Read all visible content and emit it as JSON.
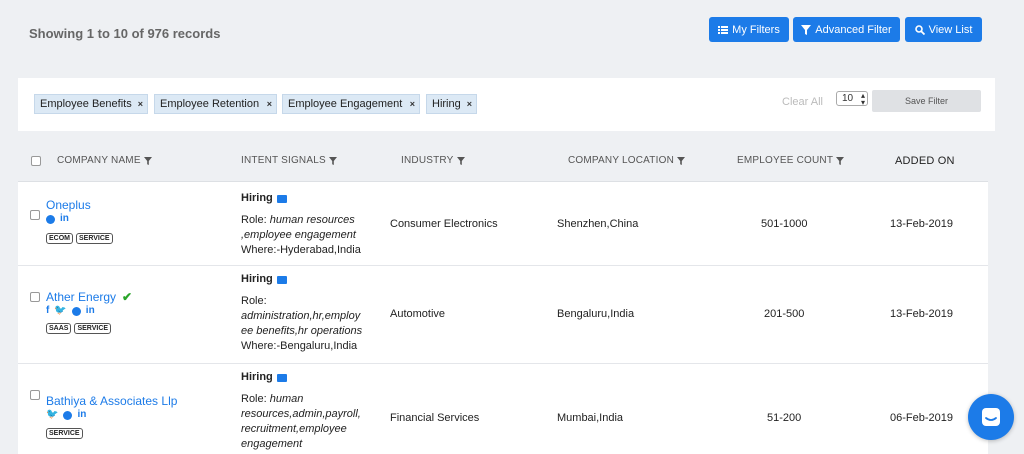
{
  "header": {
    "records_text": "Showing 1 to 10 of 976 records",
    "my_filters": "My Filters",
    "advanced_filter": "Advanced Filter",
    "view_list": "View List"
  },
  "filters": {
    "tags": [
      "Employee Benefits",
      "Employee Retention",
      "Employee Engagement",
      "Hiring"
    ],
    "remove_glyph": "×",
    "clear_all": "Clear All",
    "page_size": "10",
    "save_filter": "Save Filter"
  },
  "table": {
    "columns": {
      "company_name": "COMPANY NAME",
      "intent_signals": "INTENT SIGNALS",
      "industry": "INDUSTRY",
      "company_location": "COMPANY LOCATION",
      "employee_count": "EMPLOYEE COUNT",
      "added_on": "ADDED ON"
    },
    "rows": [
      {
        "name": "Oneplus",
        "verified": false,
        "socials": [
          "globe",
          "in"
        ],
        "badges": [
          "ECOM",
          "SERVICE"
        ],
        "signal": "Hiring",
        "role_label": "Role: ",
        "role": "human resources ,employee engagement",
        "where": "Where:-Hyderabad,India",
        "industry": "Consumer Electronics",
        "location": "Shenzhen,China",
        "employees": "501-1000",
        "added_on": "13-Feb-2019"
      },
      {
        "name": "Ather Energy",
        "verified": true,
        "socials": [
          "f",
          "twitter",
          "globe",
          "in"
        ],
        "badges": [
          "SAAS",
          "SERVICE"
        ],
        "signal": "Hiring",
        "role_label": "Role: ",
        "role": "administration,hr,employ ee benefits,hr operations",
        "where": "Where:-Bengaluru,India",
        "industry": "Automotive",
        "location": "Bengaluru,India",
        "employees": "201-500",
        "added_on": "13-Feb-2019"
      },
      {
        "name": "Bathiya & Associates Llp",
        "verified": false,
        "socials": [
          "twitter",
          "globe",
          "in"
        ],
        "badges": [
          "SERVICE"
        ],
        "signal": "Hiring",
        "role_label": "Role: ",
        "role": "human resources,admin,payroll, recruitment,employee engagement",
        "where": "",
        "industry": "Financial Services",
        "location": "Mumbai,India",
        "employees": "51-200",
        "added_on": "06-Feb-2019"
      }
    ]
  },
  "colors": {
    "accent": "#1c7be8",
    "verified": "#2aa52a",
    "page_bg": "#eef0f3"
  }
}
